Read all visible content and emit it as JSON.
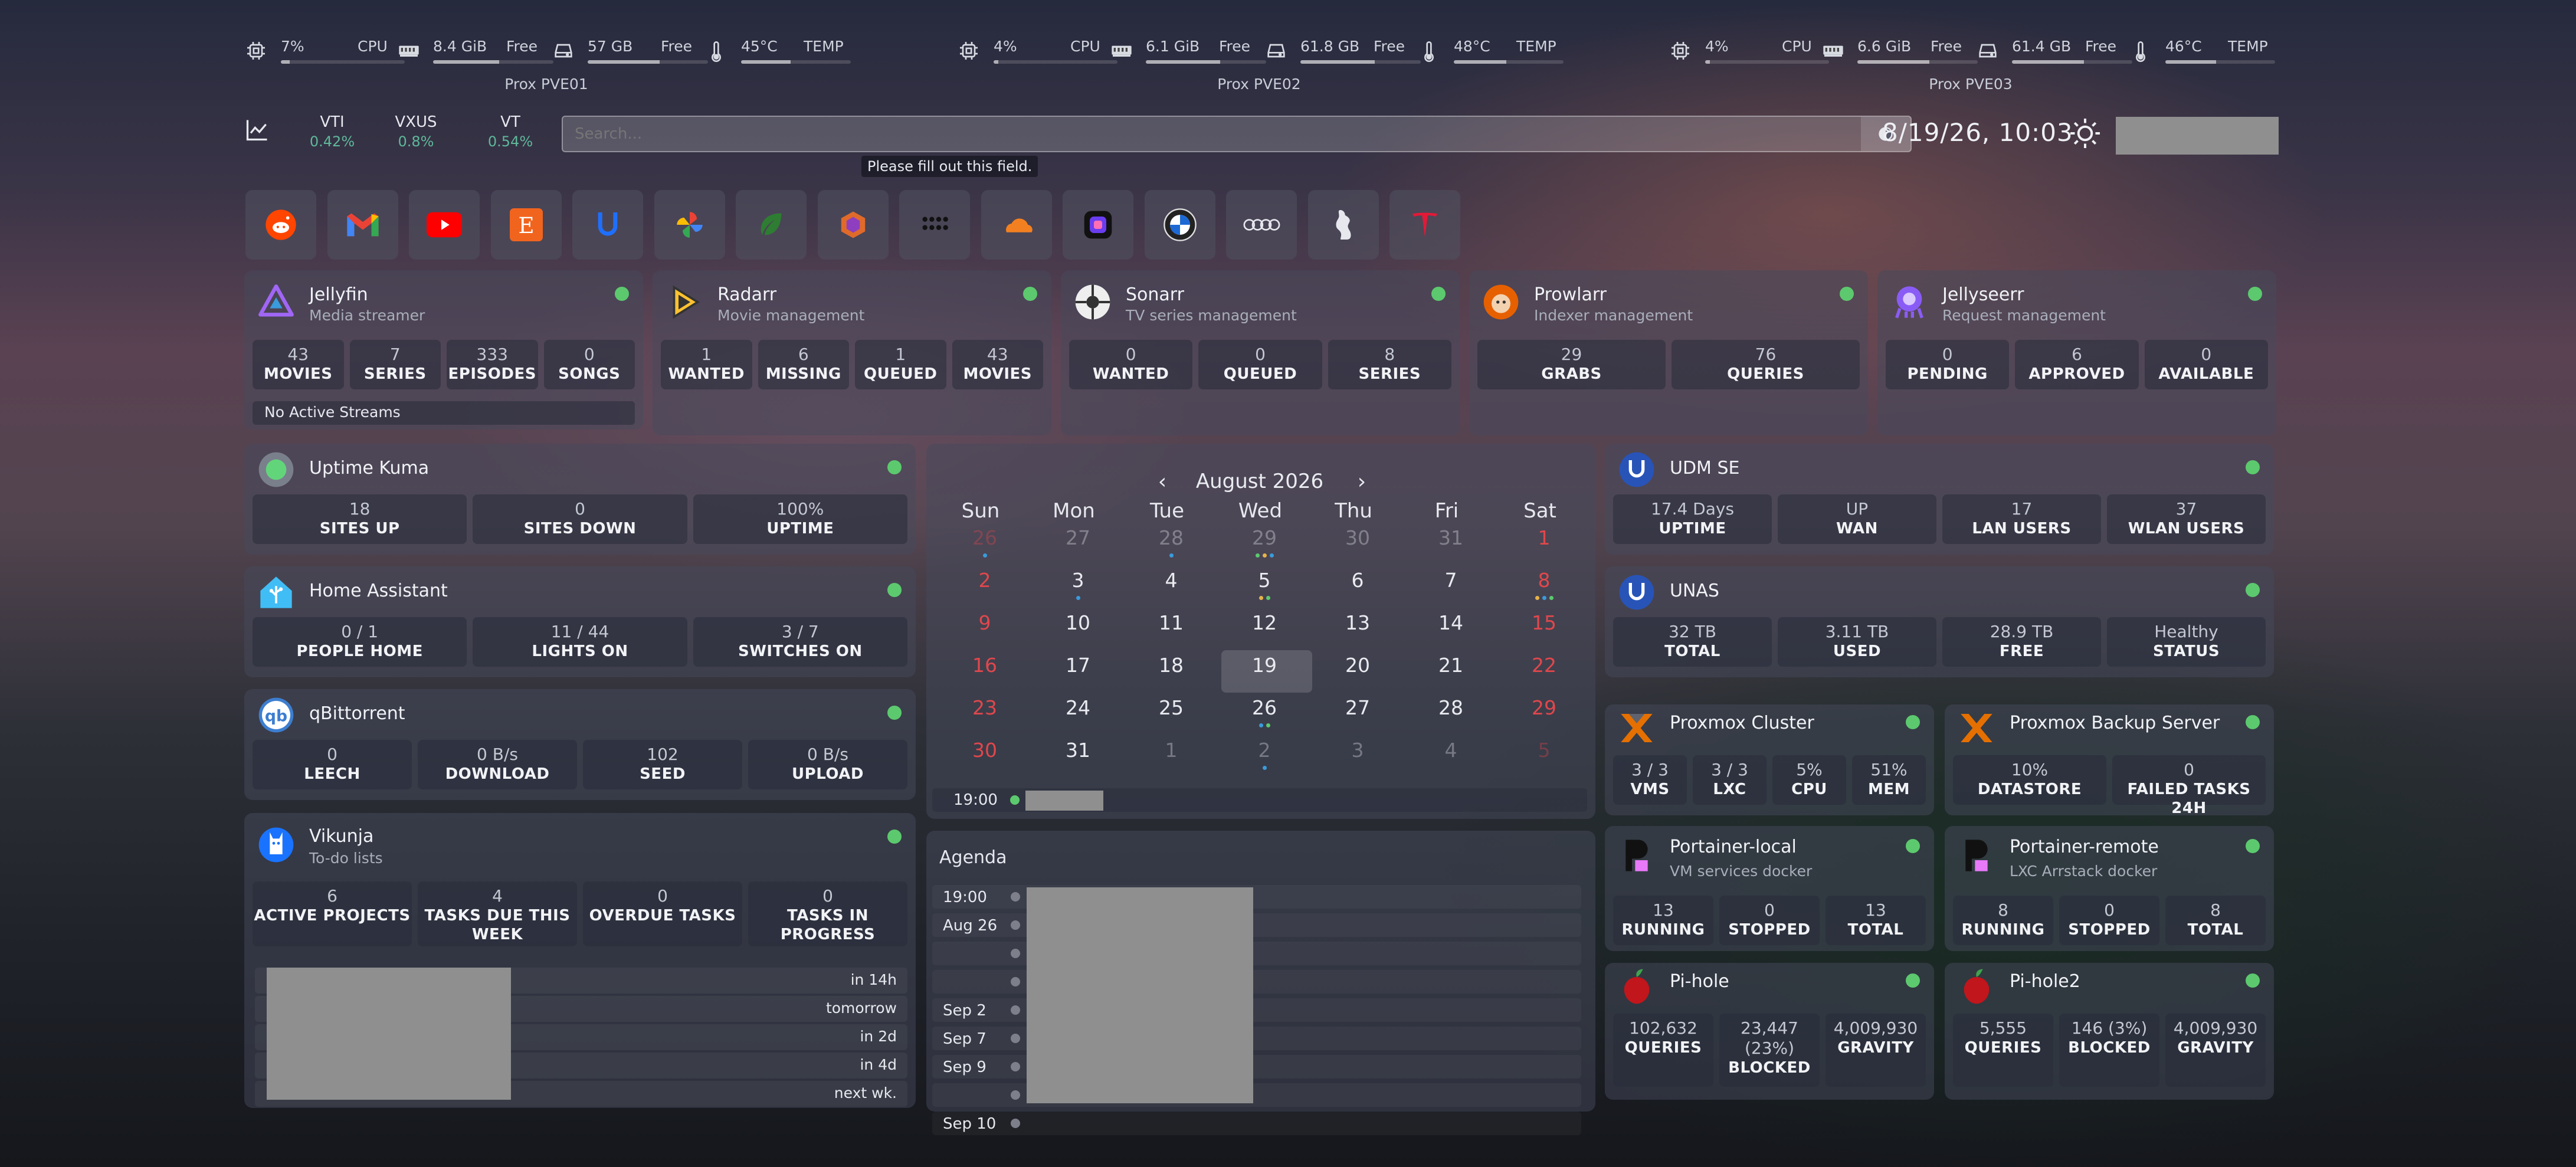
{
  "resources": [
    {
      "cpu": "7%",
      "cpu_label": "CPU",
      "cpu_pct": 7,
      "mem": "8.4 GiB",
      "mem_label": "Free",
      "mem_pct": 55,
      "disk": "57 GB",
      "disk_label": "Free",
      "disk_pct": 60,
      "temp": "45°C",
      "temp_label": "TEMP",
      "temp_pct": 45,
      "name": "Prox PVE01"
    },
    {
      "cpu": "4%",
      "cpu_label": "CPU",
      "cpu_pct": 4,
      "mem": "6.1 GiB",
      "mem_label": "Free",
      "mem_pct": 62,
      "disk": "61.8 GB",
      "disk_label": "Free",
      "disk_pct": 62,
      "temp": "48°C",
      "temp_label": "TEMP",
      "temp_pct": 48,
      "name": "Prox PVE02"
    },
    {
      "cpu": "4%",
      "cpu_label": "CPU",
      "cpu_pct": 4,
      "mem": "6.6 GiB",
      "mem_label": "Free",
      "mem_pct": 60,
      "disk": "61.4 GB",
      "disk_label": "Free",
      "disk_pct": 60,
      "temp": "46°C",
      "temp_label": "TEMP",
      "temp_pct": 46,
      "name": "Prox PVE03"
    }
  ],
  "stocks": [
    {
      "ticker": "VTI",
      "change": "0.42%"
    },
    {
      "ticker": "VXUS",
      "change": "0.8%"
    },
    {
      "ticker": "VT",
      "change": "0.54%"
    }
  ],
  "search": {
    "placeholder": "Search...",
    "tooltip": "Please fill out this field."
  },
  "datetime": "8/19/26, 10:03",
  "bookmarks": [
    "reddit-icon",
    "gmail-icon",
    "youtube-icon",
    "etsy-icon",
    "unifi-icon",
    "photos-icon",
    "leaf-icon",
    "polygon-icon",
    "dots-grid-icon",
    "cloudflare-icon",
    "app-square-icon",
    "bmw-icon",
    "audi-icon",
    "ferrari-icon",
    "tesla-icon"
  ],
  "media_services": [
    {
      "name": "Jellyfin",
      "desc": "Media streamer",
      "stats": [
        {
          "v": "43",
          "l": "MOVIES"
        },
        {
          "v": "7",
          "l": "SERIES"
        },
        {
          "v": "333",
          "l": "EPISODES"
        },
        {
          "v": "0",
          "l": "SONGS"
        }
      ],
      "footer": "No Active Streams"
    },
    {
      "name": "Radarr",
      "desc": "Movie management",
      "stats": [
        {
          "v": "1",
          "l": "WANTED"
        },
        {
          "v": "6",
          "l": "MISSING"
        },
        {
          "v": "1",
          "l": "QUEUED"
        },
        {
          "v": "43",
          "l": "MOVIES"
        }
      ]
    },
    {
      "name": "Sonarr",
      "desc": "TV series management",
      "stats": [
        {
          "v": "0",
          "l": "WANTED"
        },
        {
          "v": "0",
          "l": "QUEUED"
        },
        {
          "v": "8",
          "l": "SERIES"
        }
      ]
    },
    {
      "name": "Prowlarr",
      "desc": "Indexer management",
      "stats": [
        {
          "v": "29",
          "l": "GRABS"
        },
        {
          "v": "76",
          "l": "QUERIES"
        }
      ]
    },
    {
      "name": "Jellyseerr",
      "desc": "Request management",
      "stats": [
        {
          "v": "0",
          "l": "PENDING"
        },
        {
          "v": "6",
          "l": "APPROVED"
        },
        {
          "v": "0",
          "l": "AVAILABLE"
        }
      ]
    }
  ],
  "left_services": [
    {
      "name": "Uptime Kuma",
      "stats": [
        {
          "v": "18",
          "l": "SITES UP"
        },
        {
          "v": "0",
          "l": "SITES DOWN"
        },
        {
          "v": "100%",
          "l": "UPTIME"
        }
      ]
    },
    {
      "name": "Home Assistant",
      "stats": [
        {
          "v": "0 / 1",
          "l": "PEOPLE HOME"
        },
        {
          "v": "11 / 44",
          "l": "LIGHTS ON"
        },
        {
          "v": "3 / 7",
          "l": "SWITCHES ON"
        }
      ]
    },
    {
      "name": "qBittorrent",
      "stats": [
        {
          "v": "0",
          "l": "LEECH"
        },
        {
          "v": "0 B/s",
          "l": "DOWNLOAD"
        },
        {
          "v": "102",
          "l": "SEED"
        },
        {
          "v": "0 B/s",
          "l": "UPLOAD"
        }
      ]
    },
    {
      "name": "Vikunja",
      "desc": "To-do lists",
      "stats": [
        {
          "v": "6",
          "l": "ACTIVE PROJECTS"
        },
        {
          "v": "4",
          "l": "TASKS DUE THIS WEEK"
        },
        {
          "v": "0",
          "l": "OVERDUE TASKS"
        },
        {
          "v": "0",
          "l": "TASKS IN PROGRESS"
        }
      ],
      "due": [
        "in 14h",
        "tomorrow",
        "in 2d",
        "in 4d",
        "next wk."
      ]
    }
  ],
  "calendar": {
    "month": "August 2026",
    "prev": "‹",
    "next": "›",
    "dows": [
      "Sun",
      "Mon",
      "Tue",
      "Wed",
      "Thu",
      "Fri",
      "Sat"
    ],
    "days": [
      "26",
      "27",
      "28",
      "29",
      "30",
      "31",
      "1",
      "2",
      "3",
      "4",
      "5",
      "6",
      "7",
      "8",
      "9",
      "10",
      "11",
      "12",
      "13",
      "14",
      "15",
      "16",
      "17",
      "18",
      "19",
      "20",
      "21",
      "22",
      "23",
      "24",
      "25",
      "26",
      "27",
      "28",
      "29",
      "30",
      "31",
      "1",
      "2",
      "3",
      "4",
      "5"
    ],
    "event_time": "19:00"
  },
  "agenda": {
    "title": "Agenda",
    "rows": [
      {
        "d": "19:00"
      },
      {
        "d": "Aug 26"
      },
      {
        "d": ""
      },
      {
        "d": ""
      },
      {
        "d": "Sep 2"
      },
      {
        "d": "Sep 7"
      },
      {
        "d": "Sep 9"
      },
      {
        "d": ""
      },
      {
        "d": "Sep 10"
      }
    ]
  },
  "right_services": [
    {
      "name": "UDM SE",
      "stats": [
        {
          "v": "17.4 Days",
          "l": "UPTIME"
        },
        {
          "v": "UP",
          "l": "WAN"
        },
        {
          "v": "17",
          "l": "LAN USERS"
        },
        {
          "v": "37",
          "l": "WLAN USERS"
        }
      ]
    },
    {
      "name": "UNAS",
      "stats": [
        {
          "v": "32 TB",
          "l": "TOTAL"
        },
        {
          "v": "3.11 TB",
          "l": "USED"
        },
        {
          "v": "28.9 TB",
          "l": "FREE"
        },
        {
          "v": "Healthy",
          "l": "STATUS"
        }
      ]
    },
    {
      "name": "Proxmox Cluster",
      "stats": [
        {
          "v": "3 / 3",
          "l": "VMS"
        },
        {
          "v": "3 / 3",
          "l": "LXC"
        },
        {
          "v": "5%",
          "l": "CPU"
        },
        {
          "v": "51%",
          "l": "MEM"
        }
      ]
    },
    {
      "name": "Proxmox Backup Server",
      "stats": [
        {
          "v": "10%",
          "l": "DATASTORE"
        },
        {
          "v": "0",
          "l": "FAILED TASKS 24H"
        }
      ]
    },
    {
      "name": "Portainer-local",
      "desc": "VM services docker",
      "stats": [
        {
          "v": "13",
          "l": "RUNNING"
        },
        {
          "v": "0",
          "l": "STOPPED"
        },
        {
          "v": "13",
          "l": "TOTAL"
        }
      ]
    },
    {
      "name": "Portainer-remote",
      "desc": "LXC Arrstack docker",
      "stats": [
        {
          "v": "8",
          "l": "RUNNING"
        },
        {
          "v": "0",
          "l": "STOPPED"
        },
        {
          "v": "8",
          "l": "TOTAL"
        }
      ]
    },
    {
      "name": "Pi-hole",
      "stats": [
        {
          "v": "102,632",
          "l": "QUERIES"
        },
        {
          "v": "23,447 (23%)",
          "l": "BLOCKED"
        },
        {
          "v": "4,009,930",
          "l": "GRAVITY"
        }
      ]
    },
    {
      "name": "Pi-hole2",
      "stats": [
        {
          "v": "5,555",
          "l": "QUERIES"
        },
        {
          "v": "146 (3%)",
          "l": "BLOCKED"
        },
        {
          "v": "4,009,930",
          "l": "GRAVITY"
        }
      ]
    }
  ],
  "colors": {
    "status_ok": "#5cc96e",
    "weekend": "#e0474c",
    "stock_up": "#5fb89a"
  }
}
